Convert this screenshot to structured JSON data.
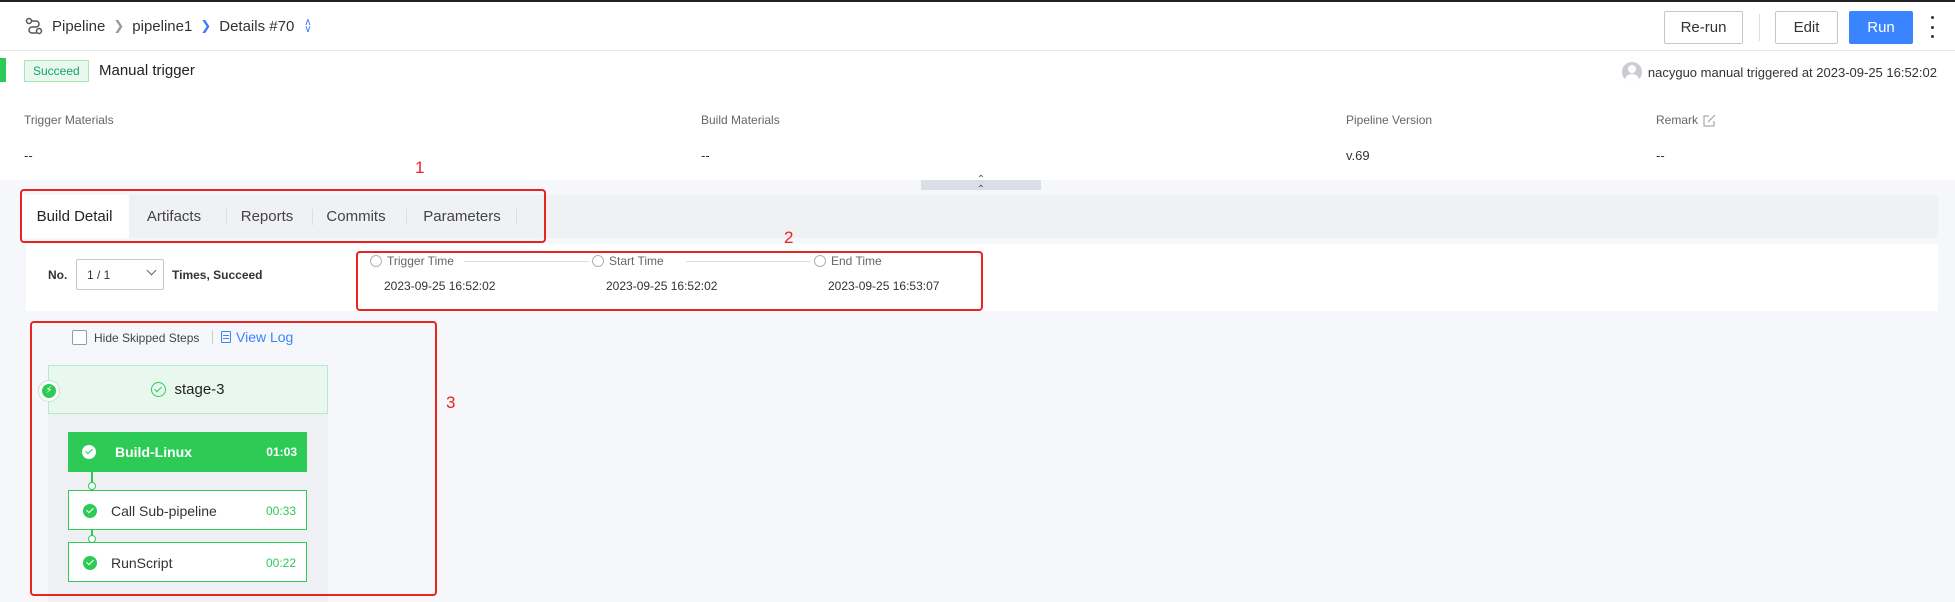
{
  "breadcrumb": {
    "root": "Pipeline",
    "pipeline": "pipeline1",
    "details": "Details #70"
  },
  "header_buttons": {
    "rerun": "Re-run",
    "edit": "Edit",
    "run": "Run"
  },
  "status": {
    "badge": "Succeed",
    "trigger_type": "Manual trigger",
    "triggered_by": "nacyguo manual triggered at 2023-09-25 16:52:02"
  },
  "info": {
    "trigger_materials_label": "Trigger Materials",
    "trigger_materials_value": "--",
    "build_materials_label": "Build Materials",
    "build_materials_value": "--",
    "pipeline_version_label": "Pipeline Version",
    "pipeline_version_value": "v.69",
    "remark_label": "Remark",
    "remark_value": "--"
  },
  "tabs": [
    {
      "label": "Build Detail",
      "active": true
    },
    {
      "label": "Artifacts"
    },
    {
      "label": "Reports"
    },
    {
      "label": "Commits"
    },
    {
      "label": "Parameters"
    }
  ],
  "execution": {
    "no_label": "No.",
    "selected": "1 / 1",
    "times_text": "Times, Succeed",
    "timeline": [
      {
        "label": "Trigger Time",
        "value": "2023-09-25 16:52:02"
      },
      {
        "label": "Start Time",
        "value": "2023-09-25 16:52:02"
      },
      {
        "label": "End Time",
        "value": "2023-09-25 16:53:07"
      }
    ]
  },
  "pipeline_view": {
    "hide_skipped_label": "Hide Skipped Steps",
    "view_log_label": "View Log",
    "stage_name": "stage-3",
    "jobs": [
      {
        "name": "Build-Linux",
        "duration": "01:03"
      },
      {
        "name": "Call Sub-pipeline",
        "duration": "00:33"
      },
      {
        "name": "RunScript",
        "duration": "00:22"
      }
    ]
  },
  "annotations": {
    "one": "1",
    "two": "2",
    "three": "3"
  },
  "colors": {
    "primary": "#3a84ff",
    "success": "#2dcb56",
    "annotation": "#e8241f"
  }
}
